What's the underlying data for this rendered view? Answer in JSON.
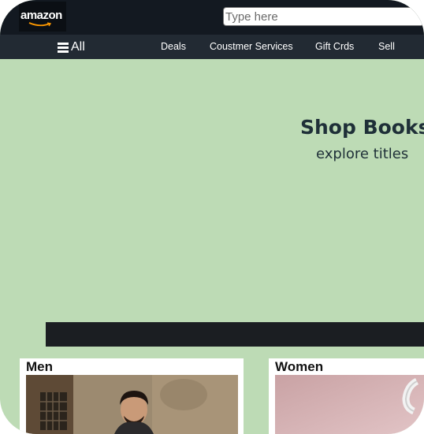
{
  "header": {
    "logo_text": "amazon",
    "search_placeholder": "Type here"
  },
  "nav": {
    "all_label": "All",
    "links": [
      "Deals",
      "Coustmer Services",
      "Gift Crds",
      "Sell"
    ]
  },
  "hero": {
    "title": "Shop Books",
    "subtitle": "explore titles",
    "background_color": "#bddbb5"
  },
  "categories": [
    {
      "title": "Men",
      "image": "man-in-suit-photo"
    },
    {
      "title": "Women",
      "image": "pink-product-photo"
    }
  ],
  "colors": {
    "topbar": "#131921",
    "navbar": "#222a33",
    "hero": "#bddbb5",
    "strip": "#1b1e22"
  }
}
